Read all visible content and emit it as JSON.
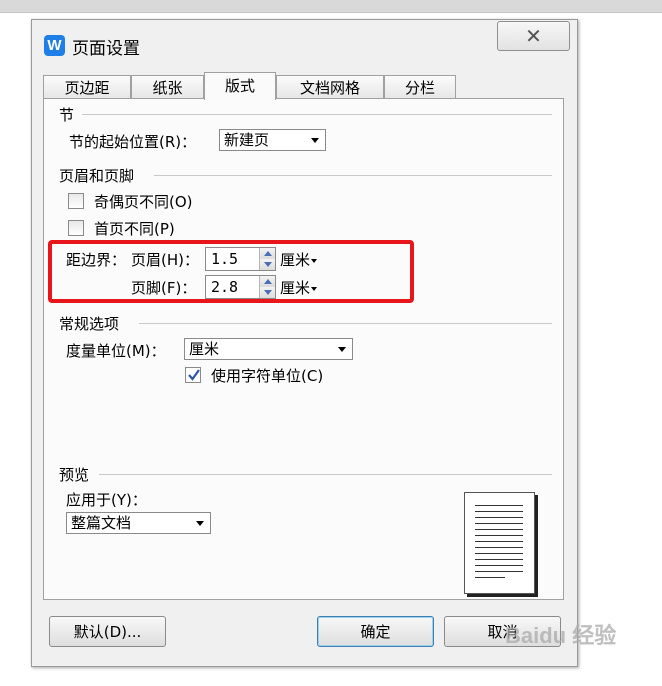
{
  "dialog": {
    "title": "页面设置",
    "app_icon_letter": "W",
    "close_label": "✕"
  },
  "tabs": [
    {
      "label": "页边距",
      "active": false
    },
    {
      "label": "纸张",
      "active": false
    },
    {
      "label": "版式",
      "active": true
    },
    {
      "label": "文档网格",
      "active": false
    },
    {
      "label": "分栏",
      "active": false
    }
  ],
  "section": {
    "group_label": "节",
    "start_label": "节的起始位置(R)：",
    "start_value": "新建页"
  },
  "header_footer": {
    "group_label": "页眉和页脚",
    "odd_even_label": "奇偶页不同(O)",
    "odd_even_checked": false,
    "first_page_label": "首页不同(P)",
    "first_page_checked": false,
    "distance_label": "距边界：",
    "header_label": "页眉(H)：",
    "header_value": "1.5",
    "header_unit": "厘米",
    "footer_label": "页脚(F)：",
    "footer_value": "2.8",
    "footer_unit": "厘米"
  },
  "general": {
    "group_label": "常规选项",
    "measure_label": "度量单位(M)：",
    "measure_value": "厘米",
    "char_unit_label": "使用字符单位(C)",
    "char_unit_checked": true
  },
  "preview": {
    "group_label": "预览",
    "apply_label": "应用于(Y)：",
    "apply_value": "整篇文档"
  },
  "buttons": {
    "default_label": "默认(D)...",
    "ok_label": "确定",
    "cancel_label": "取消"
  },
  "watermark": "Baidu 经验",
  "colors": {
    "highlight": "#e8161b",
    "app_icon": "#1f7fe6",
    "checkmark": "#2b56a8"
  }
}
